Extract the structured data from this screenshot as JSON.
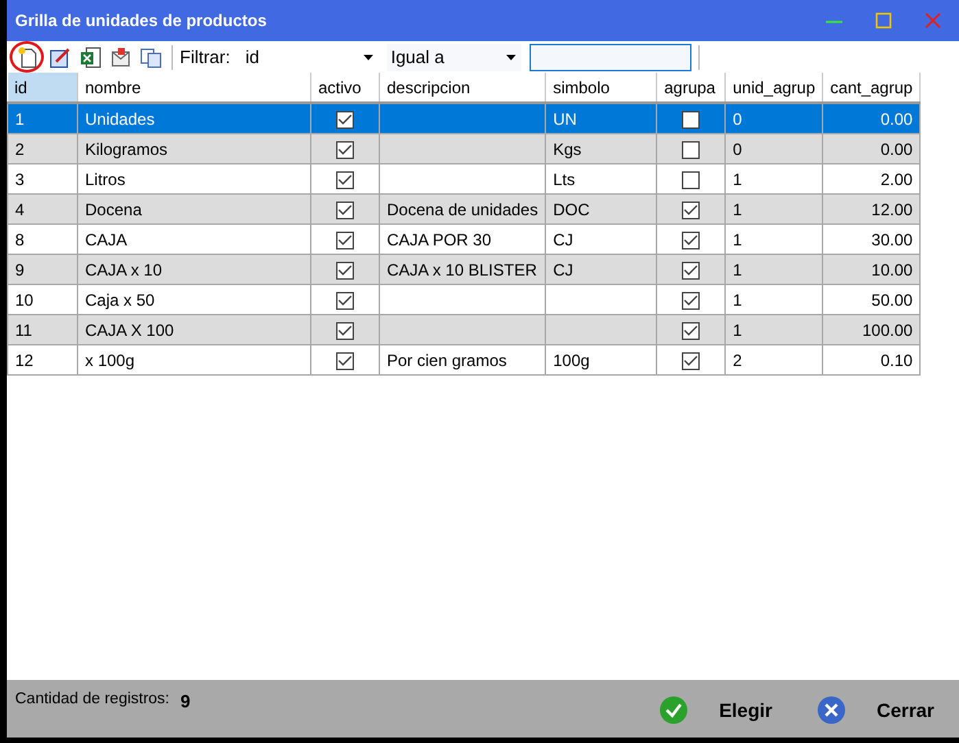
{
  "window": {
    "title": "Grilla de unidades de productos"
  },
  "toolbar": {
    "filter_label": "Filtrar:",
    "field": "id",
    "operator": "Igual a"
  },
  "table": {
    "columns": [
      {
        "label": "id",
        "kind": "text",
        "selected": true
      },
      {
        "label": "nombre",
        "kind": "text",
        "selected": false
      },
      {
        "label": "activo",
        "kind": "check",
        "selected": false
      },
      {
        "label": "descripcion",
        "kind": "text",
        "selected": false
      },
      {
        "label": "simbolo",
        "kind": "text",
        "selected": false
      },
      {
        "label": "agrupa",
        "kind": "check",
        "selected": false
      },
      {
        "label": "unid_agrup",
        "kind": "text",
        "selected": false
      },
      {
        "label": "cant_agrup",
        "kind": "number",
        "selected": false
      }
    ],
    "rows": [
      {
        "selected": true,
        "id": "1",
        "nombre": "Unidades",
        "activo": true,
        "simbolo": "UN",
        "agrupa": false,
        "unid_agrup": "0",
        "cant_agrup": "0.00"
      },
      {
        "selected": false,
        "id": "2",
        "nombre": "Kilogramos",
        "activo": true,
        "simbolo": "Kgs",
        "agrupa": false,
        "unid_agrup": "0",
        "cant_agrup": "0.00"
      },
      {
        "selected": false,
        "id": "3",
        "nombre": "Litros",
        "activo": true,
        "simbolo": "Lts",
        "agrupa": false,
        "unid_agrup": "1",
        "cant_agrup": "2.00"
      },
      {
        "selected": false,
        "id": "4",
        "nombre": "Docena",
        "activo": true,
        "descripcion": "Docena de unidades",
        "simbolo": "DOC",
        "agrupa": true,
        "unid_agrup": "1",
        "cant_agrup": "12.00"
      },
      {
        "selected": false,
        "id": "8",
        "nombre": "CAJA",
        "activo": true,
        "descripcion": "CAJA POR 30",
        "simbolo": "CJ",
        "agrupa": true,
        "unid_agrup": "1",
        "cant_agrup": "30.00"
      },
      {
        "selected": false,
        "id": "9",
        "nombre": "CAJA x 10",
        "activo": true,
        "descripcion": "CAJA x 10 BLISTER",
        "simbolo": "CJ",
        "agrupa": true,
        "unid_agrup": "1",
        "cant_agrup": "10.00"
      },
      {
        "selected": false,
        "id": "10",
        "nombre": "Caja x 50",
        "activo": true,
        "agrupa": true,
        "unid_agrup": "1",
        "cant_agrup": "50.00"
      },
      {
        "selected": false,
        "id": "11",
        "nombre": "CAJA X 100",
        "activo": true,
        "agrupa": true,
        "unid_agrup": "1",
        "cant_agrup": "100.00"
      },
      {
        "selected": false,
        "id": "12",
        "nombre": "x 100g",
        "activo": true,
        "descripcion": "Por cien gramos",
        "simbolo": "100g",
        "agrupa": true,
        "unid_agrup": "2",
        "cant_agrup": "0.10"
      }
    ]
  },
  "status_bar": {
    "count_label": "Cantidad de registros:",
    "count": "9"
  },
  "buttons": [
    {
      "label": "Elegir",
      "kind": "accept"
    },
    {
      "label": "Cerrar",
      "kind": "close"
    }
  ]
}
